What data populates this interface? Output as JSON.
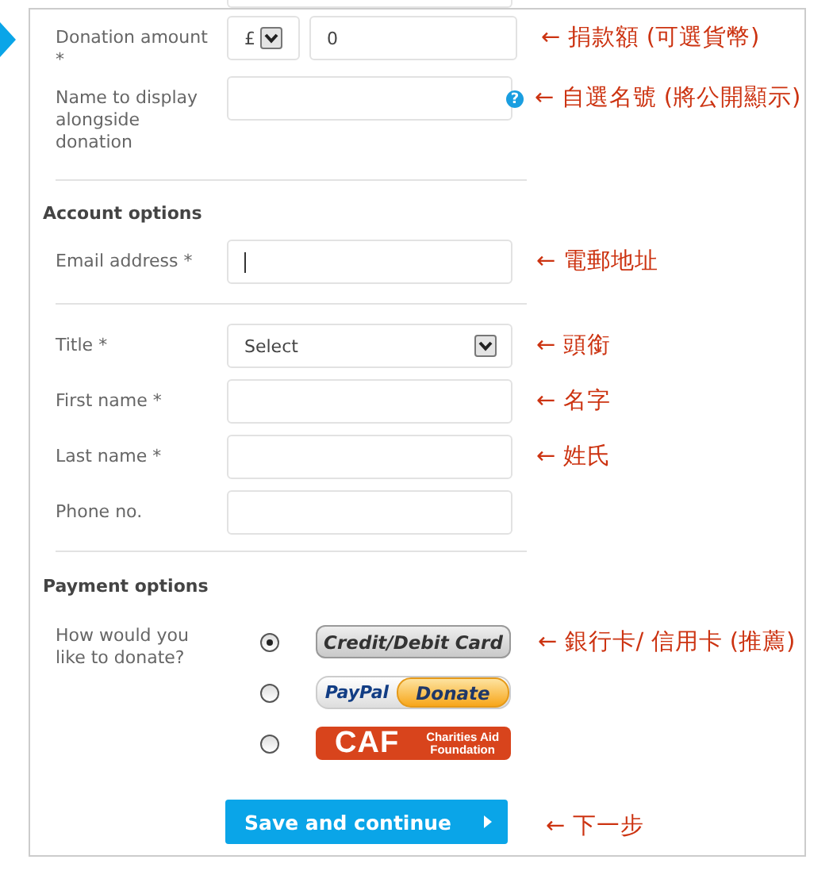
{
  "rows": [
    {
      "kind": "cut_field"
    },
    {
      "kind": "amount",
      "label": "Donation amount *",
      "currency": "£",
      "value": "0",
      "annotation": "← 捐款額 (可選貨幣)"
    },
    {
      "kind": "text",
      "label": "Name to display alongside donation",
      "focused": false,
      "help": "?",
      "annotation": "← 自選名號 (將公開顯示)"
    },
    {
      "kind": "divider"
    },
    {
      "kind": "heading",
      "text": "Account options"
    },
    {
      "kind": "text",
      "label": "Email address *",
      "focused": true,
      "annotation": "← 電郵地址"
    },
    {
      "kind": "divider"
    },
    {
      "kind": "select",
      "label": "Title *",
      "value": "Select",
      "annotation": "← 頭銜"
    },
    {
      "kind": "text",
      "label": "First name *",
      "focused": false,
      "annotation": "← 名字"
    },
    {
      "kind": "text",
      "label": "Last name *",
      "focused": false,
      "annotation": "← 姓氏"
    },
    {
      "kind": "text",
      "label": "Phone no.",
      "focused": false
    },
    {
      "kind": "divider"
    },
    {
      "kind": "heading",
      "text": "Payment options"
    },
    {
      "kind": "payment",
      "label": "How would you like to donate?",
      "options": [
        {
          "kind": "card",
          "text": "Credit/Debit Card",
          "selected": true,
          "annotation": "← 銀行卡/ 信用卡 (推薦)"
        },
        {
          "kind": "paypal",
          "brand": "PayPal",
          "action": "Donate",
          "selected": false
        },
        {
          "kind": "caf",
          "brand": "CAF",
          "name": "Charities Aid Foundation",
          "selected": false
        }
      ]
    },
    {
      "kind": "submit",
      "text": "Save and continue",
      "annotation": "← 下一步"
    }
  ]
}
